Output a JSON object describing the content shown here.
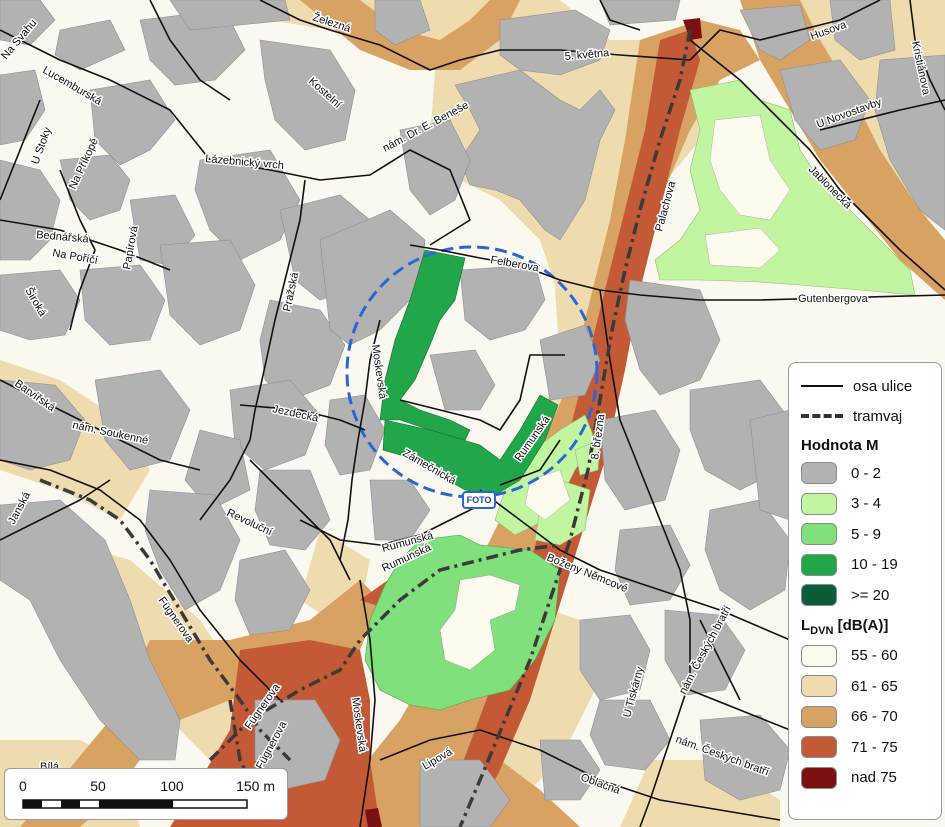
{
  "streets": {
    "zelezna": "Železná",
    "kostelni": "Kostelní",
    "petiKvetna": "5. května",
    "husova": "Husova",
    "kristianova": "Kristiánova",
    "naSvahu": "Na Svahu",
    "lucemburska": "Lucemburská",
    "uStoky": "U Stoky",
    "naPrikope": "Na Příkopě",
    "lazebnickyVrch": "Lázebnický vrch",
    "namDrEBenese": "nám. Dr. E. Beneše",
    "uNovostavby": "U Novostavby",
    "jablonecka": "Jablonecká",
    "palachova": "Palachova",
    "bednarska": "Bednářská",
    "naPorici": "Na Poříčí",
    "papirova": "Papírová",
    "prazska": "Pražská",
    "felberova": "Felberova",
    "gutenbergova": "Gutenbergova",
    "siroka": "Široká",
    "moskevska": "Moskevská",
    "barvirska": "Barvířská",
    "namSoukenne": "nám. Soukenné",
    "jezdecka": "Jezdecká",
    "zamecnicka": "Zámečnická",
    "rumunska": "Rumunská",
    "osmehoBrezna": "8. března",
    "janska": "Janská",
    "revolucni": "Revoluční",
    "rumunska2": "Rumunská",
    "rumunska3": "Rumunská",
    "bozenyNemcove": "Boženy Němcové",
    "fugnerova": "Fügnerova",
    "fugnerova2": "Fügnerova",
    "fugnerova3": "Fügnerova",
    "moskevska2": "Moskevská",
    "lipova": "Lipová",
    "uTiskarny": "U Tiskárny",
    "namCeskychBratri": "nám. Českých bratří",
    "namCeskychBratri2": "nám. Českých bratří",
    "oblacna": "Oblačná",
    "bila": "Bílá"
  },
  "foto_label": "FOTO",
  "legend": {
    "osa_ulice": "osa ulice",
    "tramvaj": "tramvaj",
    "hodnota_title": "Hodnota M",
    "hodnota_items": [
      {
        "label": "0 - 2",
        "color": "#b2b2b2"
      },
      {
        "label": "3 - 4",
        "color": "#c2f5a0"
      },
      {
        "label": "5 - 9",
        "color": "#7fe07c"
      },
      {
        "label": "10 - 19",
        "color": "#22a64a"
      },
      {
        "label": ">= 20",
        "color": "#0d5c38"
      }
    ],
    "ldvn_title_main": "L",
    "ldvn_title_sub": "DVN",
    "ldvn_title_unit": " [dB(A)]",
    "ldvn_items": [
      {
        "label": "55 - 60",
        "color": "#fdfaee"
      },
      {
        "label": "61 - 65",
        "color": "#eedcaf"
      },
      {
        "label": "66 - 70",
        "color": "#d8a262"
      },
      {
        "label": "71 - 75",
        "color": "#c45a35"
      },
      {
        "label": "nad 75",
        "color": "#7a1010"
      }
    ]
  },
  "scale": {
    "ticks": [
      "0",
      "50",
      "100",
      "150 m"
    ]
  }
}
